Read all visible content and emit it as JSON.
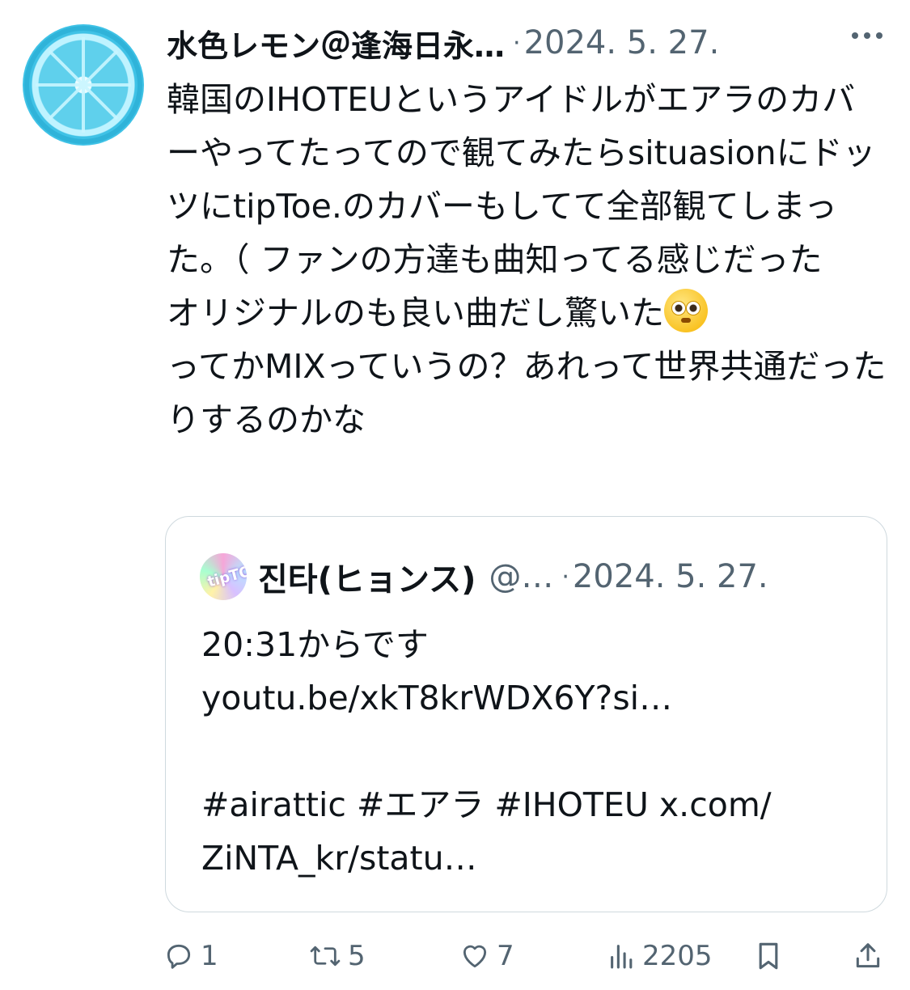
{
  "tweet": {
    "author_name": "水色レモン＠逢海日永…",
    "separator": "·",
    "date": "2024. 5. 27.",
    "text": "韓国のIHOTEUというアイドルがエアラのカバーやってたってので観てみたらsituasionにドッツにtipToe.のカバーもしてて全部観てしまった。（ ファンの方達も曲知ってる感じだった\nオリジナルのも良い曲だし驚いた",
    "text_after_emoji": "ってかMIXっていうの？あれって世界共通だったりするのかな",
    "emoji": "flushed-face"
  },
  "quote": {
    "author_name": "진타(ヒョンス)",
    "handle": "@…",
    "separator": "·",
    "date": "2024. 5. 27.",
    "avatar_text": "tipTOe",
    "text": "20:31からです\nyoutu.be/xkT8krWDX6Y?si…\n\n#airattic #エアラ #IHOTEU x.com/\nZiNTA_kr/statu…"
  },
  "actions": {
    "replies": "1",
    "retweets": "5",
    "likes": "7",
    "views": "2205"
  },
  "colors": {
    "text": "#0f1419",
    "secondary": "#536471",
    "border": "#cfd9de"
  },
  "icons": [
    "more-icon",
    "reply-icon",
    "retweet-icon",
    "like-icon",
    "views-icon",
    "bookmark-icon",
    "share-icon"
  ]
}
